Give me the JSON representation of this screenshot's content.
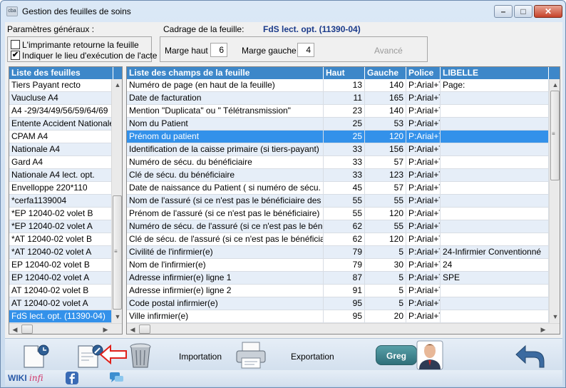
{
  "window": {
    "app_icon_text": "cba",
    "title": "Gestion des feuilles de soins",
    "min_glyph": "–",
    "max_glyph": "□",
    "close_glyph": "✕"
  },
  "params": {
    "general_label": "Paramètres généraux :",
    "printer_returns_label": "L'imprimante retourne la feuille",
    "printer_returns_checked": false,
    "indicate_place_label": "Indiquer le lieu d'exécution de l'acte",
    "indicate_place_checked": true,
    "check_mark": "✔"
  },
  "cadrage": {
    "label": "Cadrage de la feuille:",
    "sheet_name": "FdS lect. opt. (11390-04)",
    "top_margin_label": "Marge haut",
    "top_margin_value": "6",
    "left_margin_label": "Marge gauche",
    "left_margin_value": "4",
    "advanced_label": "Avancé"
  },
  "sheets": {
    "header": "Liste des feuilles",
    "items": [
      "Tiers Payant recto",
      "Vaucluse A4",
      "A4 -29/34/49/56/59/64/69",
      "Entente Accident Nationale",
      "CPAM A4",
      "Nationale A4",
      "Gard A4",
      "Nationale A4 lect. opt.",
      "Envelloppe 220*110",
      "*cerfa1139004",
      "*EP 12040-02 volet B",
      "*EP 12040-02 volet A",
      "*AT 12040-02 volet B",
      "*AT 12040-02 volet A",
      "EP 12040-02 volet B",
      "EP 12040-02 volet A",
      "AT 12040-02 volet B",
      "AT 12040-02 volet A",
      "FdS lect. opt. (11390-04)"
    ],
    "selected_index": 18
  },
  "fields": {
    "headers": [
      "Liste des champs de la feuille",
      "Haut",
      "Gauche",
      "Police",
      "LIBELLE"
    ],
    "rows": [
      [
        "Numéro de page (en haut de la feuille)",
        "13",
        "140",
        "P:Arial+T",
        "Page:"
      ],
      [
        "Date de facturation",
        "11",
        "165",
        "P:Arial+T",
        ""
      ],
      [
        "Mention \"Duplicata\" ou \" Télétransmission\"",
        "23",
        "140",
        "P:Arial+T",
        ""
      ],
      [
        "Nom du Patient",
        "25",
        "53",
        "P:Arial+T",
        ""
      ],
      [
        "Prénom du patient",
        "25",
        "120",
        "P:Arial+T",
        ""
      ],
      [
        "Identification de la caisse primaire (si tiers-payant)",
        "33",
        "156",
        "P:Arial+T",
        ""
      ],
      [
        "Numéro de sécu. du bénéficiaire",
        "33",
        "57",
        "P:Arial+T",
        ""
      ],
      [
        "Clé de sécu. du bénéficiaire",
        "33",
        "123",
        "P:Arial+T",
        ""
      ],
      [
        "Date de naissance du Patient ( si numéro de sécu. du pati",
        "45",
        "57",
        "P:Arial+T",
        ""
      ],
      [
        "Nom de l'assuré (si ce n'est pas le bénéficiaire des soins)",
        "55",
        "55",
        "P:Arial+T",
        ""
      ],
      [
        "Prénom de l'assuré (si ce n'est pas le bénéficiaire)",
        "55",
        "120",
        "P:Arial+T",
        ""
      ],
      [
        "Numéro de sécu. de l'assuré (si ce n'est pas le bénéficiaire",
        "62",
        "55",
        "P:Arial+T",
        ""
      ],
      [
        "Clé de sécu. de l'assuré (si ce n'est pas le bénéficiaire des",
        "62",
        "120",
        "P:Arial+T",
        ""
      ],
      [
        "Civilité de l'infirmier(e)",
        "79",
        "5",
        "P:Arial+T",
        "24-Infirmier Conventionné"
      ],
      [
        "Nom de l'infirmier(e)",
        "79",
        "30",
        "P:Arial+T",
        "24"
      ],
      [
        "Adresse infirmier(e) ligne 1",
        "87",
        "5",
        "P:Arial+T",
        "SPE"
      ],
      [
        "Adresse infirmier(e) ligne 2",
        "91",
        "5",
        "P:Arial+T",
        ""
      ],
      [
        "Code postal infirmier(e)",
        "95",
        "5",
        "P:Arial+T",
        ""
      ],
      [
        "Ville infirmier(e)",
        "95",
        "20",
        "P:Arial+T",
        ""
      ]
    ],
    "selected_index": 4
  },
  "toolbar": {
    "import_label": "Importation",
    "export_label": "Exportation",
    "user_label": "Greg"
  },
  "footer": {
    "wiki_label": "WIKI",
    "infi_label": "infi"
  }
}
